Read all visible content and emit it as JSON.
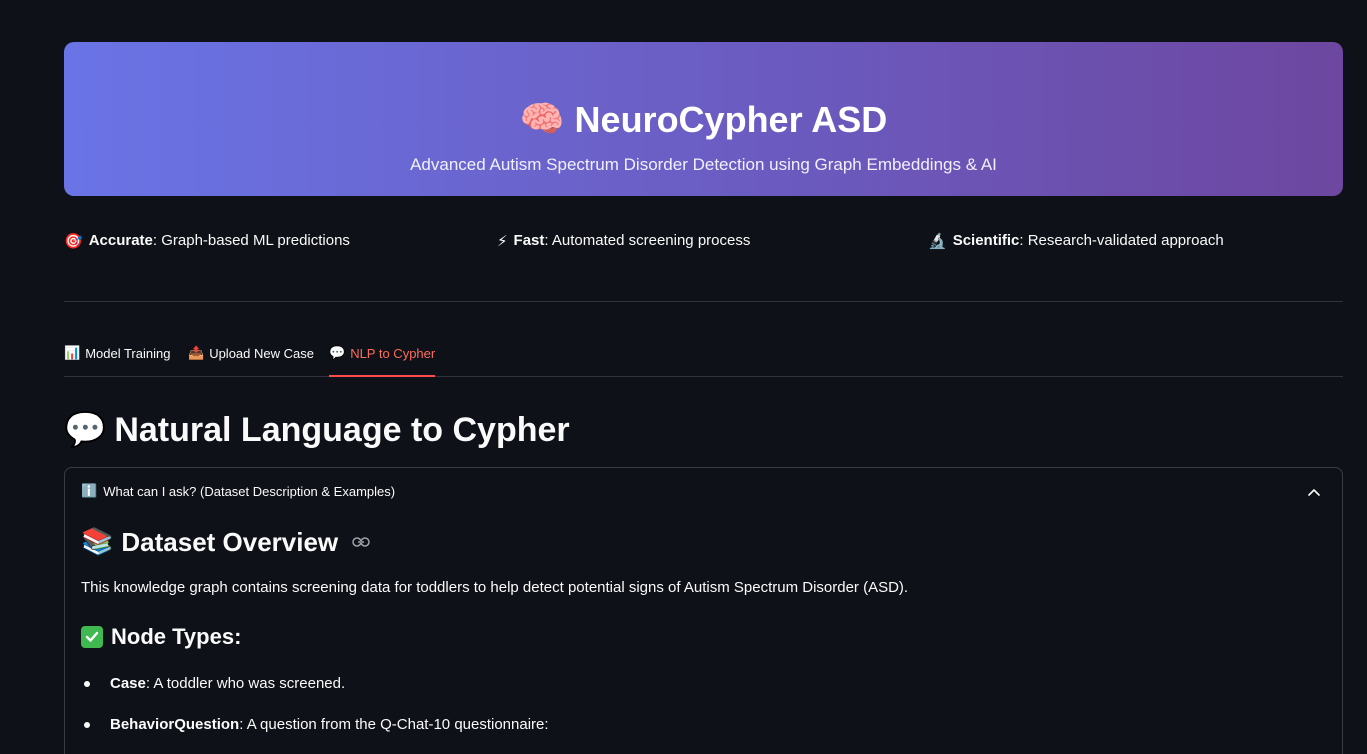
{
  "hero": {
    "icon": "🧠",
    "title": "NeuroCypher ASD",
    "subtitle": "Advanced Autism Spectrum Disorder Detection using Graph Embeddings & AI"
  },
  "features": [
    {
      "icon": "🎯",
      "label": "Accurate",
      "text": ": Graph-based ML predictions"
    },
    {
      "icon": "⚡",
      "label": "Fast",
      "text": ": Automated screening process"
    },
    {
      "icon": "🔬",
      "label": "Scientific",
      "text": ": Research-validated approach"
    }
  ],
  "tabs": [
    {
      "icon": "📊",
      "label": "Model Training"
    },
    {
      "icon": "📤",
      "label": "Upload New Case"
    },
    {
      "icon": "💬",
      "label": "NLP to Cypher",
      "active": true
    }
  ],
  "page": {
    "icon": "💬",
    "title": "Natural Language to Cypher"
  },
  "expander": {
    "icon": "ℹ️",
    "label": "What can I ask? (Dataset Description & Examples)",
    "overview_icon": "📚",
    "overview_title": "Dataset Overview",
    "overview_text": "This knowledge graph contains screening data for toddlers to help detect potential signs of Autism Spectrum Disorder (ASD).",
    "node_types_title": "Node Types:",
    "items": [
      {
        "term": "Case",
        "desc": ": A toddler who was screened."
      },
      {
        "term": "BehaviorQuestion",
        "desc": ": A question from the Q-Chat-10 questionnaire:"
      }
    ]
  },
  "colors": {
    "background": "#0e1117",
    "accent": "#ff4b4b",
    "hero_gradient_start": "#6a74e6",
    "hero_gradient_end": "#6d47a0"
  }
}
